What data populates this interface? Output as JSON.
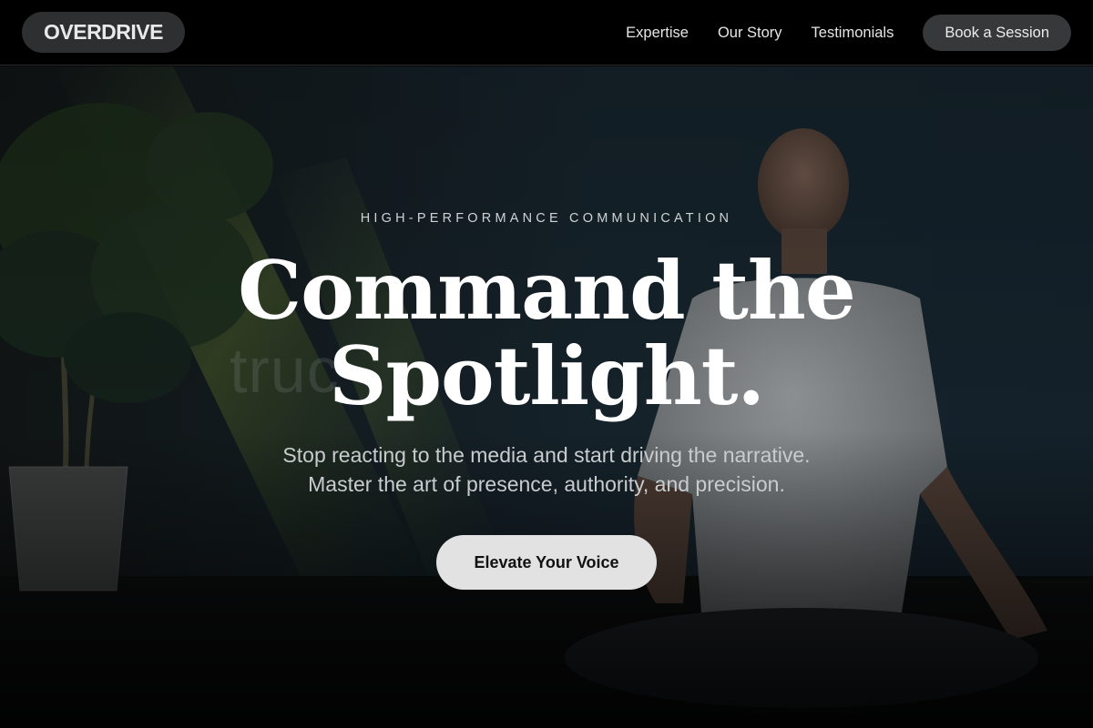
{
  "nav": {
    "logo": "OVERDRIVE",
    "links": [
      "Expertise",
      "Our Story",
      "Testimonials"
    ],
    "cta_label": "Book a Session"
  },
  "hero": {
    "background_wall_text": "truc",
    "eyebrow": "HIGH-PERFORMANCE COMMUNICATION",
    "headline_line1": "Command the",
    "headline_line2": "Spotlight.",
    "subtitle_line1": "Stop reacting to the media and start driving the narrative.",
    "subtitle_line2": "Master the art of presence, authority, and precision.",
    "cta_label": "Elevate Your Voice"
  },
  "colors": {
    "nav_bg": "#000000",
    "pill_bg": "#2e2f31",
    "cta_bg": "#e2e2e2",
    "text_primary": "#ffffff",
    "text_muted": "#c9ccce"
  }
}
